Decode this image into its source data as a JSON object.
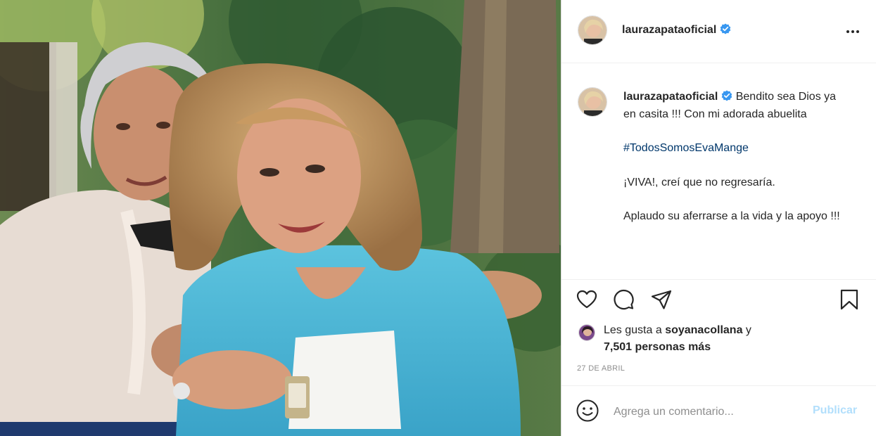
{
  "post": {
    "username": "laurazapataoficial",
    "verified": true,
    "photo_alt": "Two women smiling and embracing outdoors"
  },
  "header": {
    "more_icon": "more-horizontal-icon"
  },
  "caption": {
    "username": "laurazapataoficial",
    "lines": {
      "first": "Bendito sea Dios ya en casita !!! Con mi adorada abuelita",
      "hashtag": "#TodosSomosEvaMange",
      "second": "¡VIVA!, creí que no regresaría.",
      "third": "Aplaudo su aferrarse a la vida y la apoyo !!!"
    }
  },
  "actions": {
    "icons": [
      "heart-icon",
      "comment-icon",
      "share-icon",
      "bookmark-icon"
    ]
  },
  "likes": {
    "prefix": "Les gusta a",
    "user": "soyanacollana",
    "joiner": "y",
    "others": "7,501 personas más"
  },
  "date": "27 DE ABRIL",
  "comment_box": {
    "placeholder": "Agrega un comentario...",
    "publish_label": "Publicar"
  },
  "colors": {
    "verified": "#3897f0",
    "publish_disabled": "#b2dffc",
    "hashtag": "#00376b",
    "muted": "#8e8e8e"
  }
}
